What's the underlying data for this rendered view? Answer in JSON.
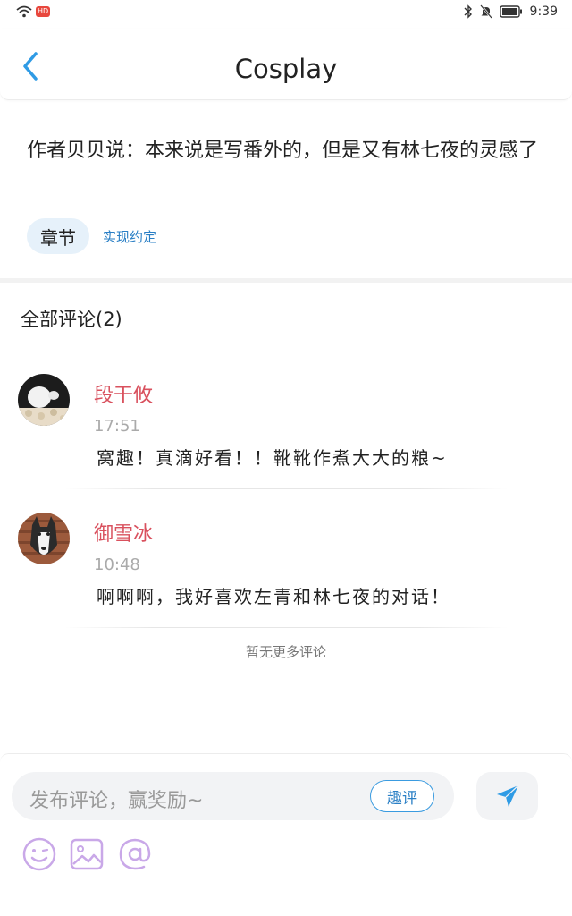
{
  "status_bar": {
    "time": "9:39",
    "badge_label": "HD"
  },
  "header": {
    "title": "Cosplay"
  },
  "author_note": {
    "text": "作者贝贝说：本来说是写番外的，但是又有林七夜的灵感了"
  },
  "chapter": {
    "chip_label": "章节",
    "link_text": "实现约定"
  },
  "comments": {
    "header": "全部评论(2)",
    "items": [
      {
        "name": "段干攸",
        "time": "17:51",
        "text": "窝趣！真滴好看！！靴靴作煮大大的粮~"
      },
      {
        "name": "御雪冰",
        "time": "10:48",
        "text": "啊啊啊，我好喜欢左青和林七夜的对话！"
      }
    ],
    "no_more": "暂无更多评论"
  },
  "bottom_bar": {
    "placeholder": "发布评论，赢奖励~",
    "quping_label": "趣评",
    "icons": [
      "emoji-icon",
      "image-icon",
      "at-icon",
      "send-icon"
    ]
  },
  "colors": {
    "accent": "#2a7fc5",
    "username": "#d9515e",
    "tool_icon": "#c9a8e8",
    "chip_bg": "#e6f1fa"
  }
}
